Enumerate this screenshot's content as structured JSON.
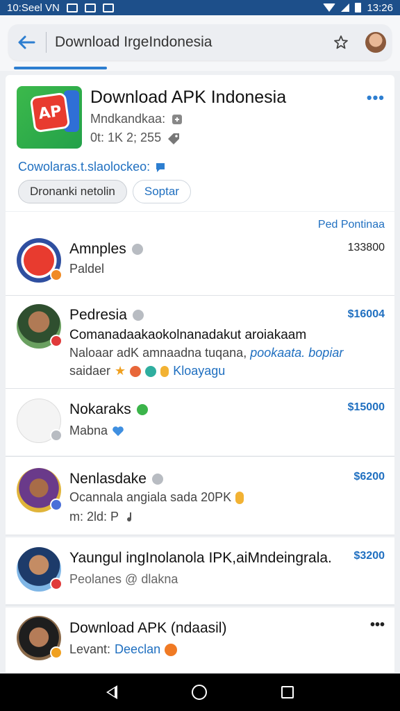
{
  "status_bar": {
    "left_text": "10:Seel VN",
    "time": "13:26"
  },
  "search": {
    "value": "Download IrgeIndonesia"
  },
  "app": {
    "title": "Download APK Indonesia",
    "subtitle": "Mndkandkaa:",
    "meta": "0t: 1K 2; 255",
    "link": "Cowolaras.t.slaolockeo:",
    "pill_primary": "Dronanki netolin",
    "pill_secondary": "Soptar",
    "icon_text": "AP"
  },
  "section_link": "Ped Pontinaa",
  "list": [
    {
      "name": "Amnples",
      "line1": "Paldel",
      "price": "133800",
      "verified": "gray"
    },
    {
      "name": "Pedresia",
      "line1": "Comanadaakaokolnanadakut aroiakaam",
      "line2_a": "Naloaar adK amnaadna tuqana,",
      "line2_b": "pookaata. bopiar",
      "line3_a": "saidaer",
      "line3_b": "Kloayagu",
      "price": "$16004",
      "verified": "gray"
    },
    {
      "name": "Nokaraks",
      "line1": "Mabna",
      "price": "$15000",
      "verified": "green"
    },
    {
      "name": "Nenlasdake",
      "line1": "Ocannala angiala sada 20PK",
      "line2": "m: 2ld: P",
      "price": "$6200",
      "verified": "gray"
    },
    {
      "name": "Yaungul ingInolanola IPK,aiMndeingrala.",
      "line1": "Peolanes @ dlakna",
      "price": "$3200",
      "verified": "none"
    },
    {
      "name": "Download APK (ndaasil)",
      "line1_a": "Levant:",
      "line1_b": "Deeclan",
      "price": "",
      "verified": "none"
    }
  ]
}
